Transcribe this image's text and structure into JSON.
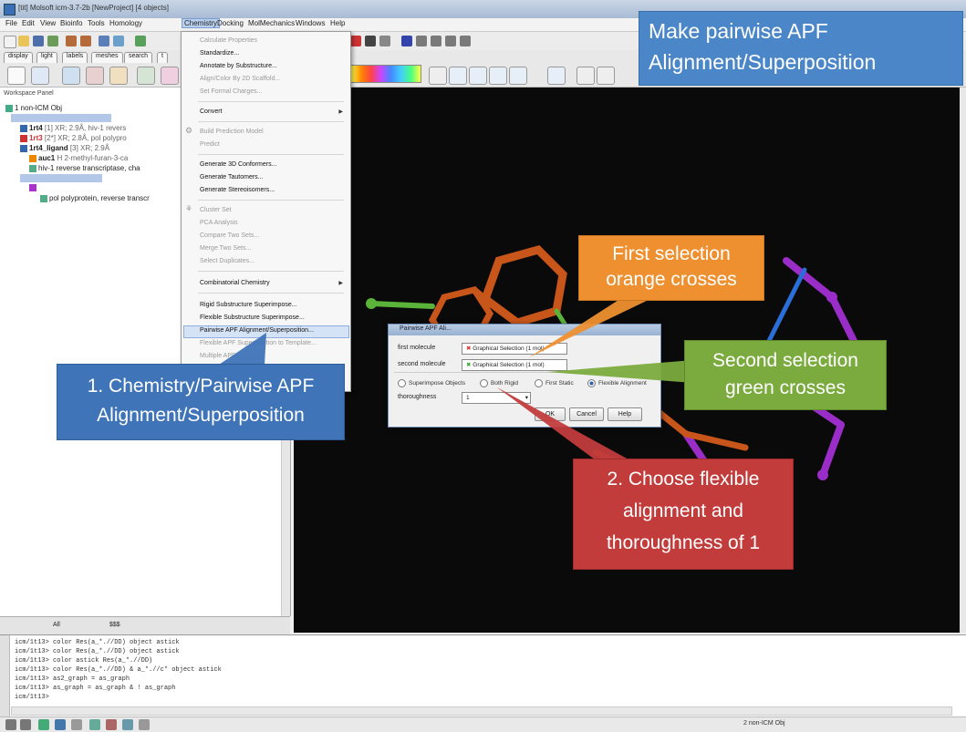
{
  "window": {
    "title": "[tit] Molsoft icm-3.7-2b [NewProject] [4 objects]"
  },
  "menubar": [
    "File",
    "Edit",
    "View",
    "Bioinfo",
    "Tools",
    "Homology",
    "Chemistry",
    "Docking",
    "MolMechanics",
    "Windows",
    "Help"
  ],
  "tabs": [
    "display",
    "light",
    "labels",
    "meshes",
    "search",
    "t"
  ],
  "workspace": {
    "title": "Workspace Panel",
    "root": "1 non-ICM Obj",
    "items": [
      {
        "name": "1rt4",
        "detail": "[1] XR; 2.9Å, hiv-1 revers"
      },
      {
        "name": "1rt3",
        "detail": "[2*] XR; 2.8Å, pol polypro"
      },
      {
        "name": "1rt4_ligand",
        "detail": "[3] XR; 2.9Å"
      },
      {
        "name": "auc1",
        "detail": "H  2-methyl-furan-3-ca"
      },
      {
        "name": "hiv-1 reverse transcriptase, cha",
        "detail": ""
      },
      {
        "name": "pol polyprotein, reverse transcr",
        "detail": ""
      }
    ],
    "tab_labels": [
      "All",
      "$$$"
    ]
  },
  "chem_menu": {
    "items": [
      {
        "label": "Calculate Properties",
        "enabled": false
      },
      {
        "label": "Standardize...",
        "enabled": true
      },
      {
        "label": "Annotate by Substructure...",
        "enabled": true
      },
      {
        "label": "Align/Color By 2D Scaffold...",
        "enabled": false
      },
      {
        "label": "Set Formal Charges...",
        "enabled": false
      },
      {
        "label": "Convert",
        "enabled": true,
        "submenu": true
      },
      {
        "label": "Build Prediction Model",
        "enabled": false
      },
      {
        "label": "Predict",
        "enabled": false
      },
      {
        "label": "Generate 3D Conformers...",
        "enabled": true
      },
      {
        "label": "Generate Tautomers...",
        "enabled": true
      },
      {
        "label": "Generate Stereoisomers...",
        "enabled": true
      },
      {
        "label": "Cluster Set",
        "enabled": false
      },
      {
        "label": "PCA Analysis",
        "enabled": false
      },
      {
        "label": "Compare Two Sets...",
        "enabled": false
      },
      {
        "label": "Merge Two Sets...",
        "enabled": false
      },
      {
        "label": "Select Duplicates...",
        "enabled": false
      },
      {
        "label": "Combinatorial Chemistry",
        "enabled": true,
        "submenu": true
      },
      {
        "label": "Rigid Substructure Superimpose...",
        "enabled": true
      },
      {
        "label": "Flexible Substructure Superimpose...",
        "enabled": true
      },
      {
        "label": "Pairwise APF Alignment/Superposition...",
        "enabled": true,
        "highlighted": true
      },
      {
        "label": "Flexible APF Superposition to Template...",
        "enabled": false
      },
      {
        "label": "Multiple APF...",
        "enabled": false
      }
    ]
  },
  "dialog": {
    "title": "Pairwise APF Ali...",
    "first_label": "first molecule",
    "first_value": "Graphical Selection (1 mol)",
    "second_label": "second molecule",
    "second_value": "Graphical Selection (1 mol)",
    "options": [
      "Superimpose Objects",
      "Both Rigid",
      "First Static",
      "Flexible Alignment"
    ],
    "selected_option": "Flexible Alignment",
    "thoroughness_label": "thoroughness",
    "thoroughness_value": "1",
    "ok_label": "OK",
    "cancel_label": "Cancel",
    "help_label": "Help"
  },
  "terminal": {
    "lines": [
      "icm/1t13> color Res(a_*.//DD) object astick",
      "icm/1t13> color Res(a_*.//DD) object astick",
      "icm/1t13> color astick Res(a_*.//DD)",
      "icm/1t13> color Res(a_*.//DD) & a_*.//c* object astick",
      "icm/1t13> as2_graph = as_graph",
      "icm/1t13> as_graph = as_graph & ! as_graph",
      "icm/1t13> "
    ]
  },
  "status": {
    "text": "2 non-ICM Obj"
  },
  "callouts": {
    "title": [
      "Make pairwise APF",
      "Alignment/Superposition"
    ],
    "orange": [
      "First selection",
      "orange crosses"
    ],
    "green": [
      "Second selection",
      "green crosses"
    ],
    "step1": [
      "1. Chemistry/Pairwise APF",
      "Alignment/Superposition"
    ],
    "step2": [
      "2. Choose flexible",
      "alignment and",
      "thoroughness of 1"
    ]
  },
  "colors": {
    "orange_callout": "#ee9030",
    "green_callout": "#7bab3e",
    "blue_callout": "#3f74b8",
    "red_callout": "#c23c3c",
    "title_callout": "#4a86c8",
    "viewer_bg": "#0a0a0a"
  }
}
